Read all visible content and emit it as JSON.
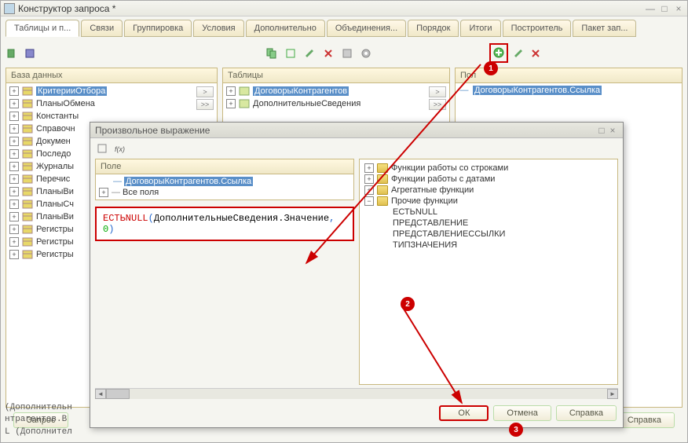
{
  "window": {
    "title": "Конструктор запроса *"
  },
  "tabs": [
    {
      "label": "Таблицы и п...",
      "active": true
    },
    {
      "label": "Связи"
    },
    {
      "label": "Группировка"
    },
    {
      "label": "Условия"
    },
    {
      "label": "Дополнительно"
    },
    {
      "label": "Объединения..."
    },
    {
      "label": "Порядок"
    },
    {
      "label": "Итоги"
    },
    {
      "label": "Построитель"
    },
    {
      "label": "Пакет зап..."
    }
  ],
  "db_panel": {
    "header": "База данных",
    "items": [
      {
        "label": "КритерииОтбора",
        "selected": true
      },
      {
        "label": "ПланыОбмена"
      },
      {
        "label": "Константы"
      },
      {
        "label": "Справочн"
      },
      {
        "label": "Докумен"
      },
      {
        "label": "Последо"
      },
      {
        "label": "Журналы"
      },
      {
        "label": "Перечис"
      },
      {
        "label": "ПланыВи"
      },
      {
        "label": "ПланыСч"
      },
      {
        "label": "ПланыВи"
      },
      {
        "label": "Регистры"
      },
      {
        "label": "Регистры"
      },
      {
        "label": "Регистры"
      }
    ]
  },
  "tables_panel": {
    "header": "Таблицы",
    "items": [
      {
        "label": "ДоговорыКонтрагентов",
        "selected": true
      },
      {
        "label": "ДополнительныеСведения"
      }
    ]
  },
  "fields_panel": {
    "header": "Пол",
    "items": [
      {
        "label": "ДоговорыКонтрагентов.Ссылка",
        "selected": true
      }
    ]
  },
  "dialog": {
    "title": "Произвольное выражение",
    "left_header": "Поле",
    "left_items": [
      {
        "label": "ДоговорыКонтрагентов.Ссылка",
        "selected": true,
        "level": 1
      },
      {
        "label": "Все поля",
        "level": 1,
        "expandable": true
      }
    ],
    "right_groups": [
      {
        "label": "Функции работы со строками",
        "expandable": true
      },
      {
        "label": "Функции работы с датами",
        "expandable": true
      },
      {
        "label": "Агрегатные функции",
        "expandable": true
      },
      {
        "label": "Прочие функции",
        "expandable": true,
        "expanded": true,
        "children": [
          "ЕСТЬNULL",
          "ПРЕДСТАВЛЕНИЕ",
          "ПРЕДСТАВЛЕНИЕССЫЛКИ",
          "ТИПЗНАЧЕНИЯ"
        ]
      }
    ],
    "expression_parts": {
      "func": "ЕСТЬNULL",
      "open": "(",
      "arg": "ДополнительныеСведения.Значение",
      "sep": ", ",
      "num": "0",
      "close": ")"
    },
    "buttons": {
      "ok": "ОК",
      "cancel": "Отмена",
      "help": "Справка"
    }
  },
  "footer": {
    "query": "Запрос",
    "help": "Справка"
  },
  "callouts": {
    "b1": "1",
    "b2": "2",
    "b3": "3"
  },
  "bottom_snippet": [
    "(Дополнительн",
    "нтрагентов.В",
    "L (Дополнител"
  ]
}
